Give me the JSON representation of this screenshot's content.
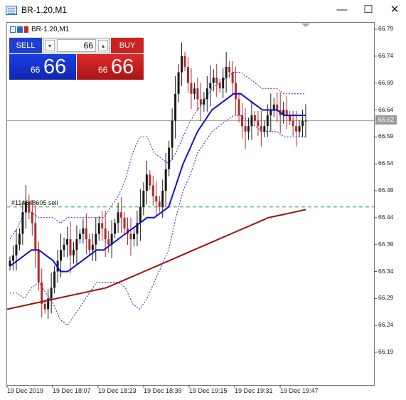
{
  "window": {
    "title": "BR-1.20,M1",
    "minimize_label": "—",
    "maximize_label": "☐",
    "close_label": "✕"
  },
  "chart_label": "BR-1.20,M1",
  "trade_panel": {
    "sell_label": "SELL",
    "buy_label": "BUY",
    "lot_value": "66",
    "lot_down_glyph": "▾",
    "lot_up_glyph": "▴",
    "sell_price_small": "66",
    "sell_price_big": "66",
    "buy_price_small": "66",
    "buy_price_big": "66"
  },
  "order_label": "#114648605 sell",
  "current_price_tag": "66.62",
  "colors": {
    "bull_candle": "#1a1a1a",
    "bear_candle": "#b22a2a",
    "ma_fast": "#1010cc",
    "ma_slow": "#a01010",
    "bands": "#2020cc",
    "order_line": "#2a9a2a",
    "sell_button": "#1f3fd0",
    "buy_button": "#cc2222"
  },
  "chart_data": {
    "type": "candlestick",
    "timeframe": "M1",
    "price_ticks": [
      "66.79",
      "66.74",
      "66.69",
      "66.64",
      "66.59",
      "66.54",
      "66.49",
      "66.44",
      "66.39",
      "66.34",
      "66.29",
      "66.24",
      "66.19"
    ],
    "time_ticks": [
      "19 Dec 2019",
      "19 Dec 18:07",
      "19 Dec 18:23",
      "19 Dec 18:39",
      "19 Dec 19:15",
      "19 Dec 19:31",
      "19 Dec 19:47"
    ],
    "ylim": [
      66.1535,
      66.8005
    ],
    "current_price": 66.62,
    "order_price": 66.46,
    "closes": [
      66.36,
      66.37,
      66.39,
      66.41,
      66.45,
      66.47,
      66.45,
      66.43,
      66.38,
      66.32,
      66.28,
      66.27,
      66.29,
      66.31,
      66.34,
      66.36,
      66.38,
      66.39,
      66.4,
      66.37,
      66.38,
      66.4,
      66.41,
      66.42,
      66.4,
      66.38,
      66.39,
      66.41,
      66.43,
      66.42,
      66.4,
      66.39,
      66.41,
      66.43,
      66.45,
      66.44,
      66.42,
      66.41,
      66.4,
      66.41,
      66.43,
      66.46,
      66.49,
      66.52,
      66.5,
      66.48,
      66.47,
      66.46,
      66.49,
      66.53,
      66.57,
      66.62,
      66.67,
      66.71,
      66.74,
      66.72,
      66.69,
      66.67,
      66.68,
      66.66,
      66.65,
      66.66,
      66.68,
      66.69,
      66.7,
      66.69,
      66.68,
      66.7,
      66.72,
      66.71,
      66.69,
      66.66,
      66.63,
      66.61,
      66.6,
      66.61,
      66.63,
      66.62,
      66.61,
      66.6,
      66.61,
      66.63,
      66.64,
      66.65,
      66.64,
      66.63,
      66.64,
      66.63,
      66.62,
      66.61,
      66.6,
      66.61,
      66.62,
      66.62
    ],
    "ma_fast_values": [
      66.35,
      66.36,
      66.37,
      66.38,
      66.38,
      66.37,
      66.36,
      66.34,
      66.34,
      66.35,
      66.36,
      66.37,
      66.38,
      66.38,
      66.39,
      66.4,
      66.41,
      66.42,
      66.43,
      66.44,
      66.44,
      66.45,
      66.46,
      66.5,
      66.54,
      66.57,
      66.6,
      66.62,
      66.64,
      66.65,
      66.66,
      66.67,
      66.67,
      66.66,
      66.65,
      66.64,
      66.64,
      66.64,
      66.63,
      66.63,
      66.63,
      66.63
    ],
    "ma_slow_values": [
      66.27,
      66.275,
      66.28,
      66.285,
      66.29,
      66.295,
      66.3,
      66.305,
      66.31,
      66.32,
      66.33,
      66.34,
      66.35,
      66.36,
      66.37,
      66.38,
      66.39,
      66.4,
      66.41,
      66.42,
      66.43,
      66.44,
      66.445,
      66.45,
      66.455
    ],
    "band_width": [
      0.05,
      0.06,
      0.08,
      0.07,
      0.06,
      0.07,
      0.08,
      0.09,
      0.1,
      0.09,
      0.08,
      0.07,
      0.06,
      0.06,
      0.07,
      0.08,
      0.1,
      0.14,
      0.16,
      0.15,
      0.12,
      0.1,
      0.08,
      0.06,
      0.05,
      0.05,
      0.04,
      0.04,
      0.04,
      0.04,
      0.04,
      0.04,
      0.04,
      0.04,
      0.04,
      0.04,
      0.04,
      0.04,
      0.04,
      0.04,
      0.04,
      0.04
    ]
  }
}
